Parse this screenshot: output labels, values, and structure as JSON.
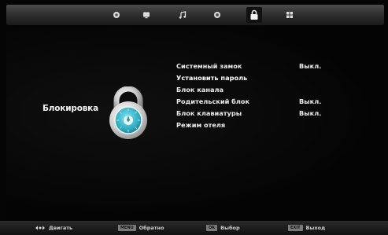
{
  "header": {
    "tabs": [
      {
        "icon": "picture-icon"
      },
      {
        "icon": "tv-icon"
      },
      {
        "icon": "music-note-icon"
      },
      {
        "icon": "clock-icon"
      },
      {
        "icon": "padlock-icon",
        "active": true
      },
      {
        "icon": "grid-icon"
      }
    ]
  },
  "page": {
    "title": "Блокировка"
  },
  "menu": {
    "items": [
      {
        "label": "Системный замок",
        "value": "Выкл."
      },
      {
        "label": "Установить пароль",
        "value": ""
      },
      {
        "label": "Блок канала",
        "value": ""
      },
      {
        "label": "Родительский блок",
        "value": "Выкл."
      },
      {
        "label": "Блок клавиатуры",
        "value": "Выкл."
      },
      {
        "label": "Режим отеля",
        "value": ""
      }
    ]
  },
  "footer": {
    "move_label": "Двигать",
    "menu_key": "MENU",
    "back_label": "Обратно",
    "ok_key": "OK",
    "select_label": "Выбор",
    "exit_key": "EXIT",
    "exit_label": "Выход"
  },
  "colors": {
    "accent": "#3bb6c9",
    "lock_metal": "#d8d8d8"
  }
}
